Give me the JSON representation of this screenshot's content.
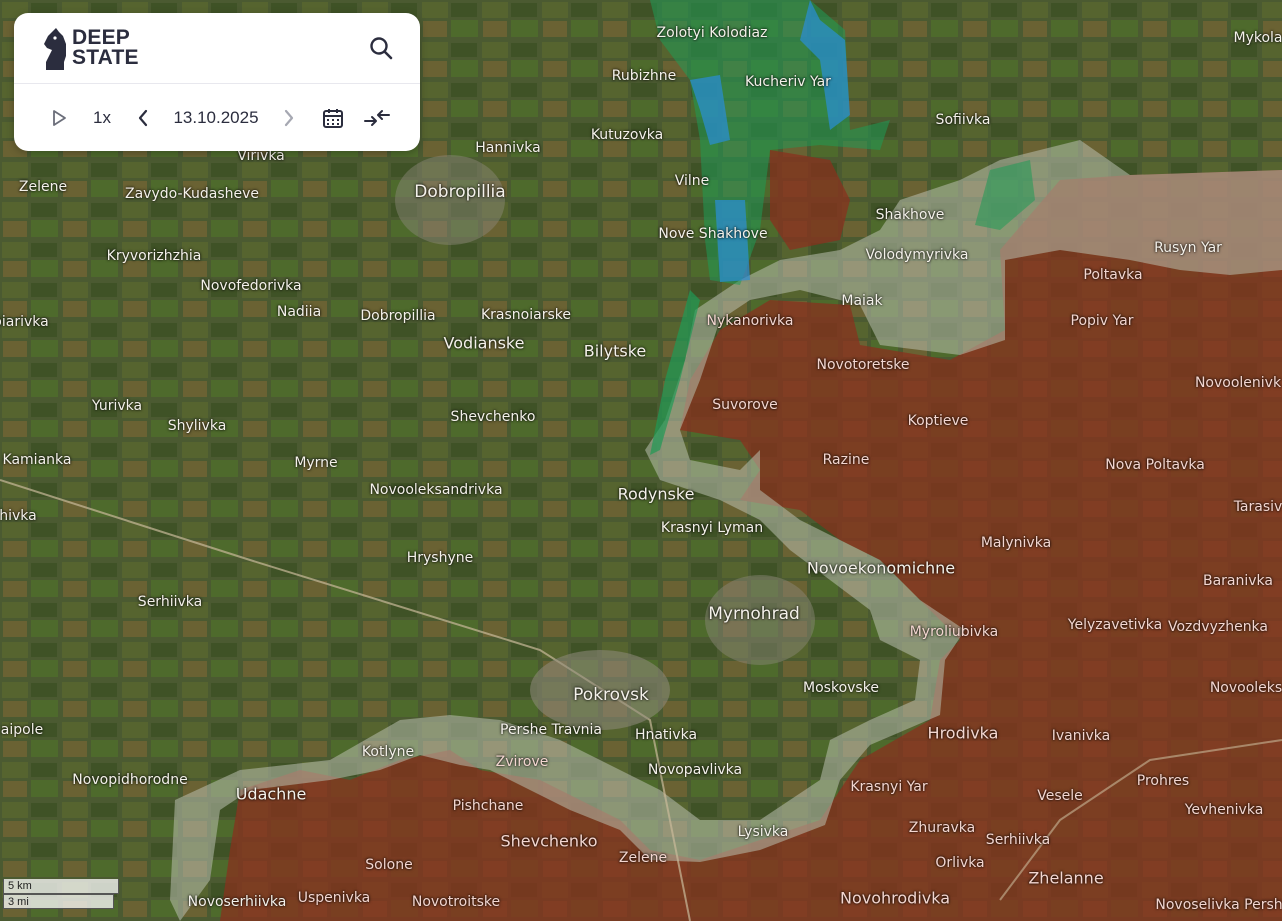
{
  "app": {
    "brand_line1": "DEEP",
    "brand_line2": "STATE"
  },
  "controls": {
    "speed": "1x",
    "date": "13.10.2025"
  },
  "icons": {
    "search": "search-icon",
    "play": "play-icon",
    "prev": "chevron-left-icon",
    "next": "chevron-right-icon",
    "calendar": "calendar-icon",
    "collapse": "collapse-arrows-icon",
    "logo": "knight-logo-icon"
  },
  "colors": {
    "occupied": "#8a2f1d",
    "contested": "#b9bfae",
    "liberated": "#1f9a55",
    "advance": "#2a8fd9"
  },
  "scale": {
    "km": "5 km",
    "mi": "3 mi"
  },
  "places": [
    {
      "name": "Zolotyi Kolodiaz",
      "type": "village",
      "status": "free"
    },
    {
      "name": "Kucheriv Yar",
      "type": "village",
      "status": "free"
    },
    {
      "name": "Mykola",
      "type": "village",
      "status": "free"
    },
    {
      "name": "Rubizhne",
      "type": "village",
      "status": "free"
    },
    {
      "name": "Sofiivka",
      "type": "village",
      "status": "free"
    },
    {
      "name": "Kutuzovka",
      "type": "village",
      "status": "free"
    },
    {
      "name": "Hannivka",
      "type": "village",
      "status": "free"
    },
    {
      "name": "Virivka",
      "type": "village",
      "status": "free"
    },
    {
      "name": "Zelene",
      "type": "village",
      "status": "free"
    },
    {
      "name": "Zavydo-Kudasheve",
      "type": "village",
      "status": "free"
    },
    {
      "name": "Dobropillia",
      "type": "city",
      "status": "free"
    },
    {
      "name": "Vilne",
      "type": "village",
      "status": "free"
    },
    {
      "name": "Shakhove",
      "type": "village",
      "status": "free"
    },
    {
      "name": "Nove Shakhove",
      "type": "village",
      "status": "free"
    },
    {
      "name": "Rusyn Yar",
      "type": "village",
      "status": "free"
    },
    {
      "name": "Kryvorizhzhia",
      "type": "village",
      "status": "free"
    },
    {
      "name": "Volodymyrivka",
      "type": "village",
      "status": "free"
    },
    {
      "name": "Poltavka",
      "type": "village",
      "status": "occ"
    },
    {
      "name": "Novofedorivka",
      "type": "village",
      "status": "free"
    },
    {
      "name": "Maiak",
      "type": "village",
      "status": "free"
    },
    {
      "name": "Nadiia",
      "type": "village",
      "status": "free"
    },
    {
      "name": "Dobropillia",
      "type": "village",
      "status": "free"
    },
    {
      "name": "Krasnoiarske",
      "type": "village",
      "status": "free"
    },
    {
      "name": "Nykanorivka",
      "type": "village",
      "status": "occ"
    },
    {
      "name": "Popiv Yar",
      "type": "village",
      "status": "occ"
    },
    {
      "name": "oiarivka",
      "type": "village",
      "status": "free"
    },
    {
      "name": "Vodianske",
      "type": "town",
      "status": "free"
    },
    {
      "name": "Bilytske",
      "type": "town",
      "status": "free"
    },
    {
      "name": "Novotoretske",
      "type": "village",
      "status": "occ"
    },
    {
      "name": "Novoolenivk",
      "type": "village",
      "status": "occ"
    },
    {
      "name": "Yurivka",
      "type": "village",
      "status": "free"
    },
    {
      "name": "Suvorove",
      "type": "village",
      "status": "occ"
    },
    {
      "name": "Shevchenko",
      "type": "village",
      "status": "free"
    },
    {
      "name": "Koptieve",
      "type": "village",
      "status": "occ"
    },
    {
      "name": "Shylivka",
      "type": "village",
      "status": "free"
    },
    {
      "name": "Kamianka",
      "type": "village",
      "status": "free"
    },
    {
      "name": "Myrne",
      "type": "village",
      "status": "free"
    },
    {
      "name": "Razine",
      "type": "village",
      "status": "occ"
    },
    {
      "name": "Nova Poltavka",
      "type": "village",
      "status": "occ"
    },
    {
      "name": "Novooleksandrivka",
      "type": "village",
      "status": "free"
    },
    {
      "name": "Rodynske",
      "type": "town",
      "status": "free"
    },
    {
      "name": "ihivka",
      "type": "village",
      "status": "free"
    },
    {
      "name": "Tarasiv",
      "type": "village",
      "status": "occ"
    },
    {
      "name": "Krasnyi Lyman",
      "type": "village",
      "status": "free"
    },
    {
      "name": "Malynivka",
      "type": "village",
      "status": "occ"
    },
    {
      "name": "Hryshyne",
      "type": "village",
      "status": "free"
    },
    {
      "name": "Novoekonomichne",
      "type": "town",
      "status": "free"
    },
    {
      "name": "Baranivka",
      "type": "village",
      "status": "occ"
    },
    {
      "name": "Serhiivka",
      "type": "village",
      "status": "free"
    },
    {
      "name": "Myrnohrad",
      "type": "city",
      "status": "free"
    },
    {
      "name": "Yelyzavetivka",
      "type": "village",
      "status": "occ"
    },
    {
      "name": "Vozdvyzhenka",
      "type": "village",
      "status": "occ"
    },
    {
      "name": "Myroliubivka",
      "type": "village",
      "status": "occ"
    },
    {
      "name": "Moskovske",
      "type": "village",
      "status": "free"
    },
    {
      "name": "Pokrovsk",
      "type": "city",
      "status": "free"
    },
    {
      "name": "Novooleks",
      "type": "village",
      "status": "occ"
    },
    {
      "name": "aipole",
      "type": "village",
      "status": "free"
    },
    {
      "name": "Pershe Travnia",
      "type": "village",
      "status": "free"
    },
    {
      "name": "Hnativka",
      "type": "village",
      "status": "free"
    },
    {
      "name": "Hrodivka",
      "type": "town",
      "status": "occ"
    },
    {
      "name": "Kotlyne",
      "type": "village",
      "status": "free"
    },
    {
      "name": "Ivanivka",
      "type": "village",
      "status": "occ"
    },
    {
      "name": "Zvirove",
      "type": "village",
      "status": "occ"
    },
    {
      "name": "Novopavlivka",
      "type": "village",
      "status": "free"
    },
    {
      "name": "Novopidhorodne",
      "type": "village",
      "status": "free"
    },
    {
      "name": "Udachne",
      "type": "town",
      "status": "free"
    },
    {
      "name": "Krasnyi Yar",
      "type": "village",
      "status": "occ"
    },
    {
      "name": "Prohres",
      "type": "village",
      "status": "occ"
    },
    {
      "name": "Pishchane",
      "type": "village",
      "status": "occ"
    },
    {
      "name": "Vesele",
      "type": "village",
      "status": "occ"
    },
    {
      "name": "Yevhenivka",
      "type": "village",
      "status": "occ"
    },
    {
      "name": "Zhuravka",
      "type": "village",
      "status": "occ"
    },
    {
      "name": "Lysivka",
      "type": "village",
      "status": "free"
    },
    {
      "name": "Shevchenko",
      "type": "town",
      "status": "occ"
    },
    {
      "name": "Serhiivka",
      "type": "village",
      "status": "occ"
    },
    {
      "name": "Zelene",
      "type": "village",
      "status": "occ"
    },
    {
      "name": "Orlivka",
      "type": "village",
      "status": "occ"
    },
    {
      "name": "Solone",
      "type": "village",
      "status": "occ"
    },
    {
      "name": "Zhelanne",
      "type": "town",
      "status": "occ"
    },
    {
      "name": "Novohrodivka",
      "type": "town",
      "status": "occ"
    },
    {
      "name": "Novoserhiivka",
      "type": "village",
      "status": "free"
    },
    {
      "name": "Uspenivka",
      "type": "village",
      "status": "occ"
    },
    {
      "name": "Novotroitske",
      "type": "village",
      "status": "occ"
    },
    {
      "name": "Novoselivka Persh",
      "type": "village",
      "status": "occ"
    }
  ]
}
